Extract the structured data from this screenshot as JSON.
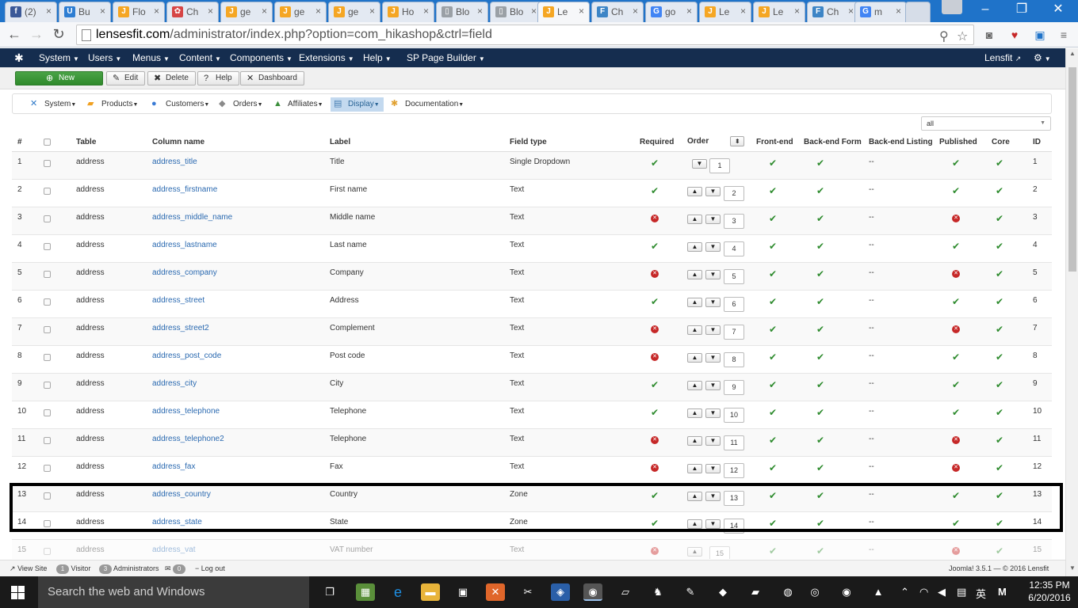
{
  "browser": {
    "tabs": [
      {
        "title": "(2)",
        "icon": "facebook-icon",
        "color": "#3b5998",
        "glyph": "f"
      },
      {
        "title": "Bu",
        "icon": "shield-icon",
        "color": "#2d7dd2",
        "glyph": "U"
      },
      {
        "title": "Flo",
        "icon": "joomla-icon",
        "color": "#f5a623",
        "glyph": "J"
      },
      {
        "title": "Ch",
        "icon": "flower-icon",
        "color": "#d64545",
        "glyph": "✿"
      },
      {
        "title": "ge",
        "icon": "joomla-icon",
        "color": "#f5a623",
        "glyph": "J"
      },
      {
        "title": "ge",
        "icon": "joomla-icon",
        "color": "#f5a623",
        "glyph": "J"
      },
      {
        "title": "ge",
        "icon": "joomla-icon",
        "color": "#f5a623",
        "glyph": "J"
      },
      {
        "title": "Ho",
        "icon": "joomla-icon",
        "color": "#f5a623",
        "glyph": "J"
      },
      {
        "title": "Blo",
        "icon": "page-icon",
        "color": "#9aa0a6",
        "glyph": "▯"
      },
      {
        "title": "Blo",
        "icon": "page-icon",
        "color": "#9aa0a6",
        "glyph": "▯"
      },
      {
        "title": "Le",
        "icon": "joomla-icon",
        "color": "#f5a623",
        "glyph": "J",
        "active": true
      },
      {
        "title": "Ch",
        "icon": "table-icon",
        "color": "#3d85c6",
        "glyph": "F"
      },
      {
        "title": "go",
        "icon": "google-icon",
        "color": "#4285f4",
        "glyph": "G"
      },
      {
        "title": "Le",
        "icon": "joomla-icon",
        "color": "#f5a623",
        "glyph": "J"
      },
      {
        "title": "Le",
        "icon": "joomla-icon",
        "color": "#f5a623",
        "glyph": "J"
      },
      {
        "title": "Ch",
        "icon": "table-icon",
        "color": "#3d85c6",
        "glyph": "F"
      },
      {
        "title": "m",
        "icon": "google-icon",
        "color": "#4285f4",
        "glyph": "G"
      }
    ],
    "url_host": "lensesfit.com",
    "url_rest": "/administrator/index.php?option=com_hikashop&ctrl=field"
  },
  "joomla_nav": {
    "menus": [
      "System",
      "Users",
      "Menus",
      "Content",
      "Components",
      "Extensions",
      "Help",
      "SP Page Builder"
    ],
    "site_link": "Lensfit"
  },
  "toolbar": {
    "new": "New",
    "edit": "Edit",
    "delete": "Delete",
    "help": "Help",
    "dashboard": "Dashboard"
  },
  "hika_menu": [
    {
      "label": "System",
      "icon": "tools-icon",
      "glyph": "✕",
      "color": "#2c78c8"
    },
    {
      "label": "Products",
      "icon": "box-icon",
      "glyph": "▰",
      "color": "#f0a020"
    },
    {
      "label": "Customers",
      "icon": "users-icon",
      "glyph": "●",
      "color": "#3a7bd5"
    },
    {
      "label": "Orders",
      "icon": "orders-icon",
      "glyph": "◆",
      "color": "#8a8a8a"
    },
    {
      "label": "Affiliates",
      "icon": "affiliates-icon",
      "glyph": "▲",
      "color": "#3c8f3c"
    },
    {
      "label": "Display",
      "icon": "display-icon",
      "glyph": "▤",
      "color": "#4a7fb3",
      "active": true
    },
    {
      "label": "Documentation",
      "icon": "documentation-icon",
      "glyph": "✱",
      "color": "#e0a030"
    }
  ],
  "filter": {
    "value": "all"
  },
  "table": {
    "headers": {
      "num": "#",
      "table": "Table",
      "column": "Column name",
      "label": "Label",
      "type": "Field type",
      "required": "Required",
      "order": "Order",
      "frontend": "Front-end",
      "backend_form": "Back-end Form",
      "backend_listing": "Back-end Listing",
      "published": "Published",
      "core": "Core",
      "id": "ID"
    },
    "rows": [
      {
        "num": "1",
        "table": "address",
        "column": "address_title",
        "label": "Title",
        "type": "Single Dropdown",
        "required": true,
        "order": "1",
        "listing": "--",
        "published": true,
        "core": true,
        "id": "1"
      },
      {
        "num": "2",
        "table": "address",
        "column": "address_firstname",
        "label": "First name",
        "type": "Text",
        "required": true,
        "order": "2",
        "listing": "--",
        "published": true,
        "core": true,
        "id": "2"
      },
      {
        "num": "3",
        "table": "address",
        "column": "address_middle_name",
        "label": "Middle name",
        "type": "Text",
        "required": false,
        "order": "3",
        "listing": "--",
        "published": false,
        "core": true,
        "id": "3"
      },
      {
        "num": "4",
        "table": "address",
        "column": "address_lastname",
        "label": "Last name",
        "type": "Text",
        "required": true,
        "order": "4",
        "listing": "--",
        "published": true,
        "core": true,
        "id": "4"
      },
      {
        "num": "5",
        "table": "address",
        "column": "address_company",
        "label": "Company",
        "type": "Text",
        "required": false,
        "order": "5",
        "listing": "--",
        "published": false,
        "core": true,
        "id": "5"
      },
      {
        "num": "6",
        "table": "address",
        "column": "address_street",
        "label": "Address",
        "type": "Text",
        "required": true,
        "order": "6",
        "listing": "--",
        "published": true,
        "core": true,
        "id": "6"
      },
      {
        "num": "7",
        "table": "address",
        "column": "address_street2",
        "label": "Complement",
        "type": "Text",
        "required": false,
        "order": "7",
        "listing": "--",
        "published": false,
        "core": true,
        "id": "7"
      },
      {
        "num": "8",
        "table": "address",
        "column": "address_post_code",
        "label": "Post code",
        "type": "Text",
        "required": false,
        "order": "8",
        "listing": "--",
        "published": true,
        "core": true,
        "id": "8"
      },
      {
        "num": "9",
        "table": "address",
        "column": "address_city",
        "label": "City",
        "type": "Text",
        "required": true,
        "order": "9",
        "listing": "--",
        "published": true,
        "core": true,
        "id": "9"
      },
      {
        "num": "10",
        "table": "address",
        "column": "address_telephone",
        "label": "Telephone",
        "type": "Text",
        "required": true,
        "order": "10",
        "listing": "--",
        "published": true,
        "core": true,
        "id": "10"
      },
      {
        "num": "11",
        "table": "address",
        "column": "address_telephone2",
        "label": "Telephone",
        "type": "Text",
        "required": false,
        "order": "11",
        "listing": "--",
        "published": false,
        "core": true,
        "id": "11"
      },
      {
        "num": "12",
        "table": "address",
        "column": "address_fax",
        "label": "Fax",
        "type": "Text",
        "required": false,
        "order": "12",
        "listing": "--",
        "published": false,
        "core": true,
        "id": "12"
      },
      {
        "num": "13",
        "table": "address",
        "column": "address_country",
        "label": "Country",
        "type": "Zone",
        "required": true,
        "order": "13",
        "listing": "--",
        "published": true,
        "core": true,
        "id": "13"
      },
      {
        "num": "14",
        "table": "address",
        "column": "address_state",
        "label": "State",
        "type": "Zone",
        "required": true,
        "order": "14",
        "listing": "--",
        "published": true,
        "core": true,
        "id": "14"
      },
      {
        "num": "15",
        "table": "address",
        "column": "address_vat",
        "label": "VAT number",
        "type": "Text",
        "required": false,
        "order": "15",
        "listing": "--",
        "published": false,
        "core": true,
        "id": "15"
      }
    ]
  },
  "status": {
    "view_site": "View Site",
    "visitors_count": "1",
    "visitors": "Visitor",
    "admins_count": "3",
    "admins": "Administrators",
    "messages_count": "0",
    "logout": "Log out",
    "version": "Joomla! 3.5.1 — © 2016 Lensfit"
  },
  "taskbar": {
    "search_placeholder": "Search the web and Windows",
    "time": "12:35 PM",
    "date": "6/20/2016",
    "ime": "英",
    "ime2": "M"
  }
}
